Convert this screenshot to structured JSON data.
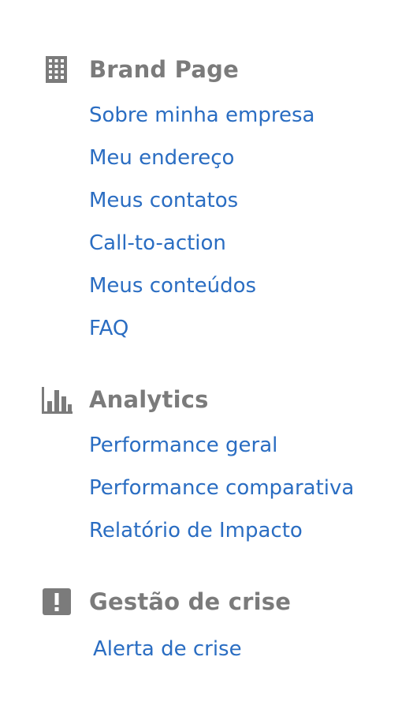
{
  "colors": {
    "heading": "#7b7b7b",
    "link": "#2a6dc2",
    "icon": "#7b7b7b"
  },
  "sections": [
    {
      "title": "Brand Page",
      "icon": "building-icon",
      "items": [
        {
          "label": "Sobre minha empresa"
        },
        {
          "label": "Meu endereço"
        },
        {
          "label": "Meus contatos"
        },
        {
          "label": "Call-to-action"
        },
        {
          "label": "Meus conteúdos"
        },
        {
          "label": "FAQ"
        }
      ]
    },
    {
      "title": "Analytics",
      "icon": "bar-chart-icon",
      "items": [
        {
          "label": "Performance geral"
        },
        {
          "label": "Performance comparativa"
        },
        {
          "label": "Relatório de Impacto"
        }
      ]
    },
    {
      "title": "Gestão de crise",
      "icon": "alert-icon",
      "items": [
        {
          "label": "Alerta de crise"
        }
      ]
    }
  ]
}
